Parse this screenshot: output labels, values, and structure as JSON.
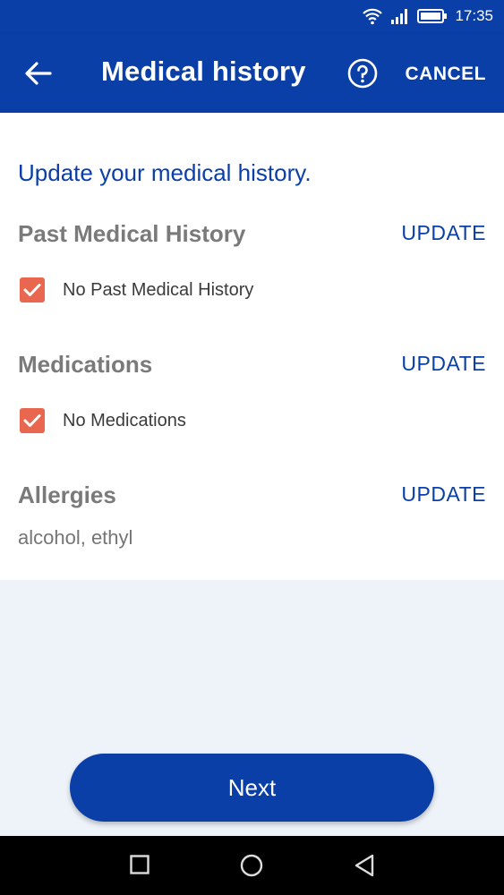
{
  "status_bar": {
    "time": "17:35"
  },
  "app_bar": {
    "title": "Medical history",
    "cancel_label": "CANCEL"
  },
  "content": {
    "intro": "Update your medical history.",
    "sections": [
      {
        "title": "Past Medical History",
        "update_label": "UPDATE",
        "checkbox_label": "No Past Medical History",
        "checked": true
      },
      {
        "title": "Medications",
        "update_label": "UPDATE",
        "checkbox_label": "No Medications",
        "checked": true
      },
      {
        "title": "Allergies",
        "update_label": "UPDATE",
        "value": "alcohol, ethyl"
      }
    ]
  },
  "next_label": "Next",
  "colors": {
    "primary": "#0a3fa8",
    "checkbox": "#e8674e",
    "background": "#eef3fa"
  }
}
